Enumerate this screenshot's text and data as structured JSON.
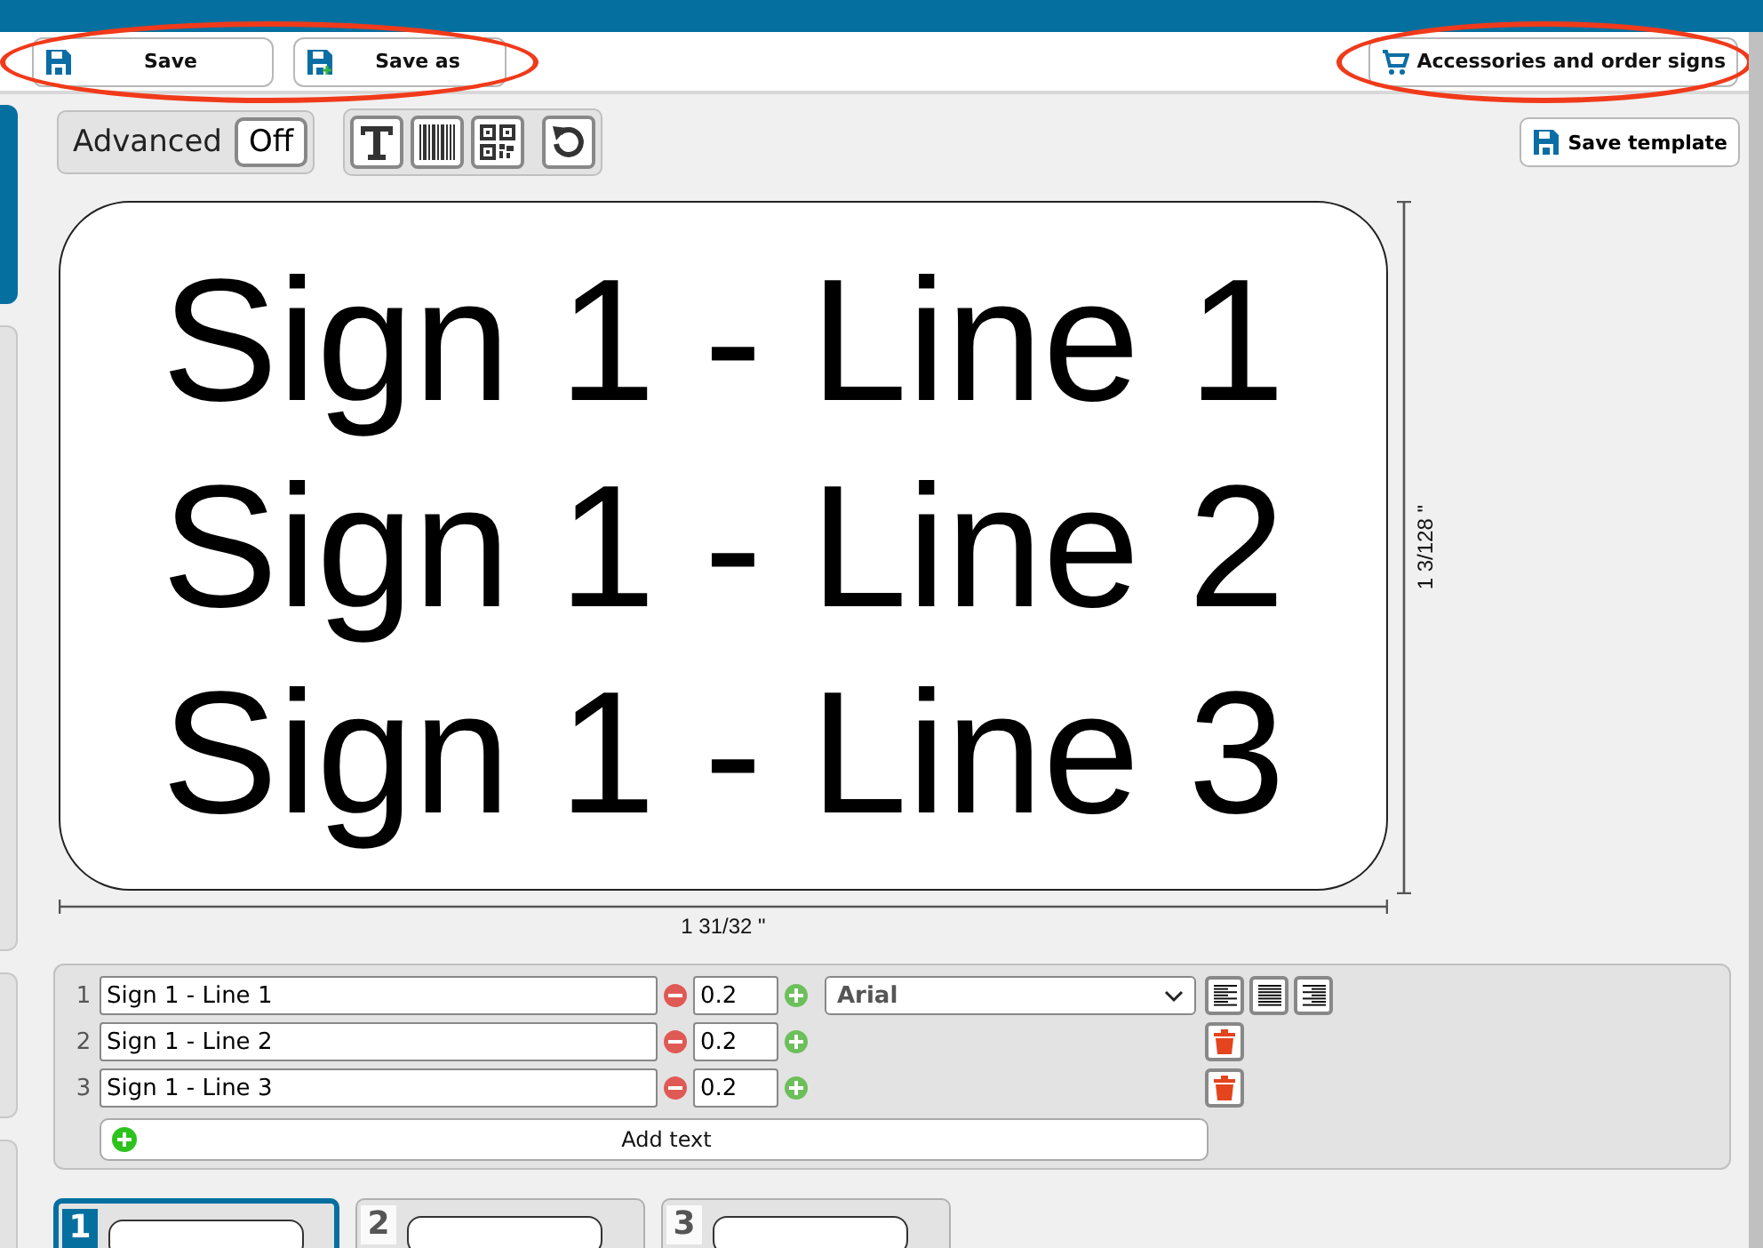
{
  "toolbar": {
    "left_group": {
      "highlighted": true,
      "buttons": [
        {
          "kind": "save",
          "label": "Save"
        },
        {
          "kind": "save_as",
          "label": "Save as"
        }
      ]
    },
    "right_group": {
      "highlighted": true,
      "button": {
        "label": "Accessories and order signs"
      }
    }
  },
  "advanced": {
    "label": "Advanced",
    "value": "Off"
  },
  "tools": [
    {
      "kind": "text"
    },
    {
      "kind": "barcode"
    },
    {
      "kind": "qr"
    },
    {
      "kind": "reset"
    }
  ],
  "save_template": {
    "label": "Save template"
  },
  "sign": {
    "lines": [
      "Sign 1 - Line 1",
      "Sign 1 - Line 2",
      "Sign 1 - Line 3"
    ],
    "width": "1 31/32 \"",
    "height": "1 3/128 \""
  },
  "editor": {
    "font": "Arial",
    "rows": [
      {
        "number": "1",
        "text": "Sign 1 - Line 1",
        "size": "0.2"
      },
      {
        "number": "2",
        "text": "Sign 1 - Line 2",
        "size": "0.2"
      },
      {
        "number": "3",
        "text": "Sign 1 - Line 3",
        "size": "0.2"
      }
    ],
    "align": [
      {
        "kind": "left"
      },
      {
        "kind": "justify"
      },
      {
        "kind": "right"
      }
    ],
    "add_text": "Add text"
  },
  "sign_tabs": [
    {
      "number": "1",
      "selected": true
    },
    {
      "number": "2",
      "selected": false
    },
    {
      "number": "3",
      "selected": false
    }
  ]
}
